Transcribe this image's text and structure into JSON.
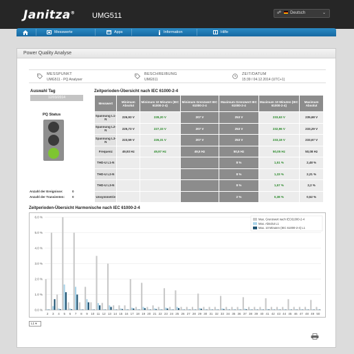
{
  "header": {
    "brand": "Janitza",
    "brand_mark": "®",
    "device": "UMG511",
    "language": "Deutsch"
  },
  "nav": {
    "items": [
      {
        "label": "",
        "icon": "home-icon"
      },
      {
        "label": "Messwerte",
        "icon": "measurements-icon"
      },
      {
        "label": "Apps",
        "icon": "apps-icon"
      },
      {
        "label": "Information",
        "icon": "info-icon"
      },
      {
        "label": "Hilfe",
        "icon": "help-icon"
      }
    ]
  },
  "panel": {
    "title": "Power Quality Analyse",
    "info": [
      {
        "label": "MESSPUNKT",
        "value": "UMG511 - PQ Analyser",
        "icon": "tag-icon"
      },
      {
        "label": "BESCHREIBUNG",
        "value": "UMG511",
        "icon": "tag-icon"
      },
      {
        "label": "ZEIT/DATUM",
        "value": "15:39 / 04.12.2014 (UTC+1)",
        "icon": "clock-icon"
      }
    ]
  },
  "sidebar": {
    "day_title": "Auswahl Tag",
    "date": "12/03/2014",
    "pq_status": "PQ Status",
    "events_label": "Anzahl der Ereignisse:",
    "events_value": "0",
    "transients_label": "Anzahl der Transienten:",
    "transients_value": "0",
    "lamp_colors": [
      "#3a3a3a",
      "#3a3a3a",
      "#7ec531"
    ]
  },
  "table": {
    "title": "Zeitperioden-Übersicht nach IEC 61000-2-4",
    "headers": [
      "Messwert",
      "Minimum Absolut",
      "Minimum 10 Minuten (IEC 61000-2-4)",
      "Minimum Grenzwert IEC 61000-2-4",
      "Maximum Grenzwert IEC 61000-2-4",
      "Maximum 10 Minuten (IEC 61000-2-4)",
      "Maximum Absolut"
    ],
    "rows": [
      [
        "Spannung L1-N",
        "226,93 V",
        "228,20 V",
        "207 V",
        "253 V",
        "233,63 V",
        "235,68 V"
      ],
      [
        "Spannung L2-N",
        "225,73 V",
        "227,33 V",
        "207 V",
        "253 V",
        "232,96 V",
        "233,29 V"
      ],
      [
        "Spannung L3-N",
        "223,59 V",
        "226,31 V",
        "207 V",
        "253 V",
        "233,18 V",
        "233,67 V"
      ],
      [
        "Frequenz",
        "49,93 Hz",
        "49,97 Hz",
        "49,5 Hz",
        "50,5 Hz",
        "50,05 Hz",
        "50,08 Hz"
      ],
      [
        "THD-U L1-N",
        "",
        "",
        "",
        "8 %",
        "1,51 %",
        "2,48 %"
      ],
      [
        "THD-U L2-N",
        "",
        "",
        "",
        "8 %",
        "1,33 %",
        "2,21 %"
      ],
      [
        "THD-U L3-N",
        "",
        "",
        "",
        "8 %",
        "1,57 %",
        "2,2 %"
      ],
      [
        "Unsymmetrie",
        "",
        "",
        "",
        "2 %",
        "0,38 %",
        "0,52 %"
      ]
    ]
  },
  "harmonics": {
    "title": "Zeitperioden-Übersicht Harmonische nach IEC 61000-2-4",
    "selector": "L1",
    "chart_data": {
      "type": "bar",
      "title": "",
      "xlabel": "",
      "ylabel": "",
      "ylim": [
        0,
        6.0
      ],
      "ytick_labels": [
        "0.0 %",
        "1.0 %",
        "2.0 %",
        "3.0 %",
        "4.0 %",
        "5.0 %",
        "6.0 %"
      ],
      "legend_position": "top-right",
      "categories": [
        2,
        3,
        4,
        5,
        6,
        7,
        8,
        9,
        10,
        11,
        12,
        13,
        14,
        15,
        16,
        17,
        18,
        19,
        20,
        21,
        22,
        23,
        24,
        25,
        26,
        27,
        28,
        29,
        30,
        31,
        32,
        33,
        34,
        35,
        36,
        37,
        38,
        39,
        40,
        41,
        42,
        43,
        44,
        45,
        46,
        47,
        48,
        49,
        50
      ],
      "series": [
        {
          "name": "Max. Grenzwert nach IEC61000-2-4",
          "color": "#c8c8c8",
          "values": [
            2.0,
            5.0,
            1.0,
            6.0,
            0.5,
            5.0,
            0.5,
            1.5,
            0.5,
            3.5,
            0.46,
            3.0,
            0.3,
            0.3,
            0.3,
            2.0,
            0.2,
            1.76,
            0.2,
            0.3,
            0.2,
            1.41,
            0.2,
            1.27,
            0.2,
            0.2,
            0.2,
            1.06,
            0.2,
            0.2,
            0.2,
            0.91,
            0.2,
            0.2,
            0.2,
            0.83,
            0.2,
            0.2,
            0.2,
            0.76,
            0.2,
            0.2,
            0.2,
            0.7,
            0.2,
            0.2,
            0.2,
            0.65,
            0.2
          ]
        },
        {
          "name": "Max. Absolut L1",
          "color": "#a9d4ea",
          "values": [
            0.05,
            0.25,
            0.1,
            1.65,
            0.1,
            1.5,
            0.05,
            0.7,
            0.05,
            0.45,
            0.05,
            0.3,
            0.05,
            0.1,
            0.05,
            0.15,
            0.05,
            0.2,
            0.05,
            0.1,
            0.05,
            0.15,
            0.05,
            0.2,
            0.05,
            0.05,
            0.05,
            0.12,
            0.05,
            0.05,
            0.05,
            0.1,
            0.05,
            0.05,
            0.05,
            0.08,
            0.05,
            0.05,
            0.05,
            0.06,
            0.05,
            0.05,
            0.05,
            0.05,
            0.05,
            0.05,
            0.05,
            0.04,
            0.04
          ]
        },
        {
          "name": "Max. 10 Minuten (IEC 61000-2-4) L1",
          "color": "#1a4f6e",
          "values": [
            0.03,
            0.7,
            0.05,
            1.15,
            0.05,
            1.0,
            0.03,
            0.5,
            0.03,
            0.3,
            0.03,
            0.2,
            0.03,
            0.06,
            0.03,
            0.1,
            0.03,
            0.12,
            0.03,
            0.06,
            0.03,
            0.1,
            0.03,
            0.12,
            0.03,
            0.03,
            0.03,
            0.08,
            0.03,
            0.03,
            0.03,
            0.06,
            0.03,
            0.03,
            0.03,
            0.05,
            0.03,
            0.03,
            0.03,
            0.04,
            0.03,
            0.03,
            0.03,
            0.03,
            0.03,
            0.03,
            0.03,
            0.03,
            0.03
          ]
        }
      ]
    }
  }
}
